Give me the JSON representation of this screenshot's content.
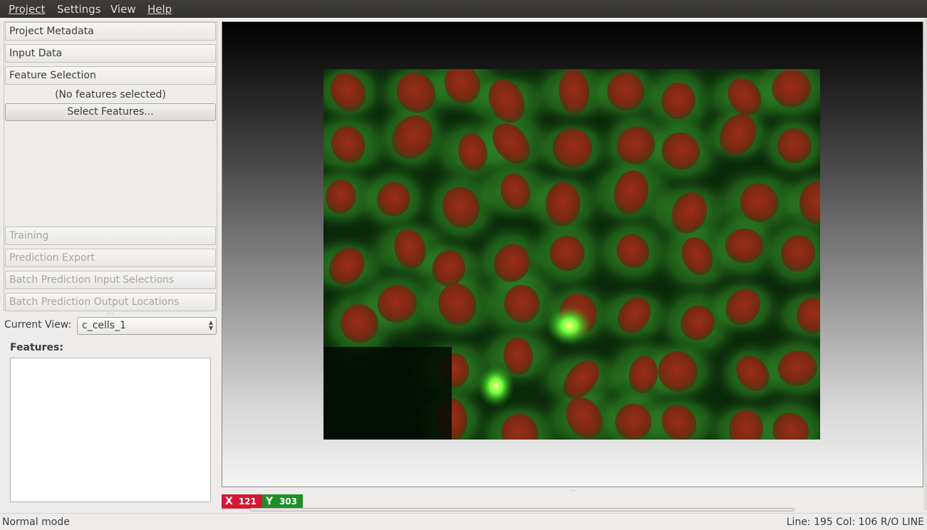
{
  "menubar": {
    "items": [
      {
        "label": "Project"
      },
      {
        "label": "Settings"
      },
      {
        "label": "View"
      },
      {
        "label": "Help"
      }
    ]
  },
  "applet_drawer": {
    "sections": [
      {
        "label": "Project Metadata",
        "enabled": true
      },
      {
        "label": "Input Data",
        "enabled": true
      },
      {
        "label": "Feature Selection",
        "enabled": true
      },
      {
        "label": "Training",
        "enabled": false
      },
      {
        "label": "Prediction Export",
        "enabled": false
      },
      {
        "label": "Batch Prediction Input Selections",
        "enabled": false
      },
      {
        "label": "Batch Prediction Output Locations",
        "enabled": false
      }
    ],
    "feature_selection": {
      "status_text": "(No features selected)",
      "select_button_label": "Select Features..."
    }
  },
  "current_view": {
    "label": "Current View:",
    "selected": "c_cells_1"
  },
  "features_panel": {
    "label": "Features:",
    "items": []
  },
  "viewer": {
    "image_subject": "fluorescence microscopy cells",
    "colors": {
      "nuclei": "#8a2a14",
      "cytoplasm": "#2f8a24",
      "background": "#062006"
    }
  },
  "position": {
    "x_axis": "X",
    "x_value": "121",
    "y_axis": "Y",
    "y_value": "303",
    "colors": {
      "x": "#d41735",
      "y": "#1e8e2a"
    }
  },
  "statusbar": {
    "mode": "Normal mode",
    "position_text": "Line: 195 Col: 106 R/O LINE"
  }
}
